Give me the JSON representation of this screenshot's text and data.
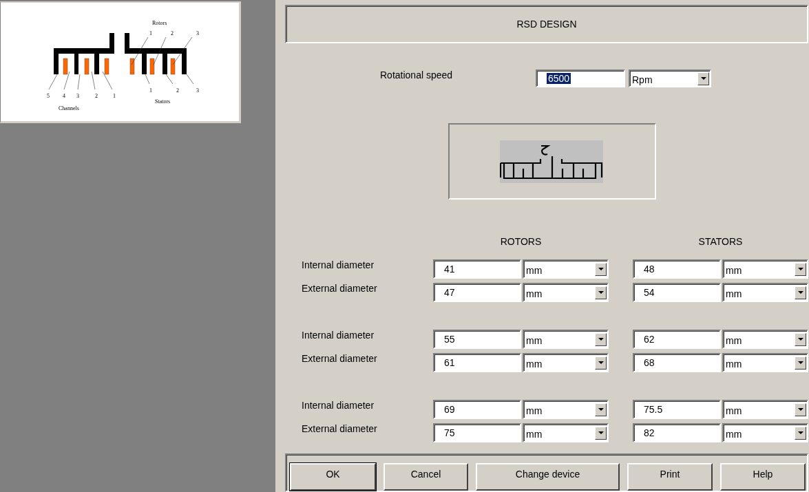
{
  "diagram": {
    "rotors_label": "Rotors",
    "rotor_numbers": [
      "1",
      "2",
      "3"
    ],
    "channel_numbers": [
      "5",
      "4",
      "3",
      "2",
      "1"
    ],
    "stator_numbers": [
      "1",
      "2",
      "3"
    ],
    "channels_label": "Channels",
    "stators_label": "Stators"
  },
  "dialog": {
    "title": "RSD DESIGN"
  },
  "speed": {
    "label": "Rotational speed",
    "value": "6500",
    "text_selected": true,
    "unit": "Rpm"
  },
  "columns": [
    "ROTORS",
    "STATORS"
  ],
  "groups": [
    {
      "rows": [
        {
          "label": "Internal diameter",
          "rotor": {
            "value": "41",
            "unit": "mm"
          },
          "stator": {
            "value": "48",
            "unit": "mm"
          }
        },
        {
          "label": "External diameter",
          "rotor": {
            "value": "47",
            "unit": "mm"
          },
          "stator": {
            "value": "54",
            "unit": "mm"
          }
        }
      ]
    },
    {
      "rows": [
        {
          "label": "Internal diameter",
          "rotor": {
            "value": "55",
            "unit": "mm"
          },
          "stator": {
            "value": "62",
            "unit": "mm"
          }
        },
        {
          "label": "External diameter",
          "rotor": {
            "value": "61",
            "unit": "mm"
          },
          "stator": {
            "value": "68",
            "unit": "mm"
          }
        }
      ]
    },
    {
      "rows": [
        {
          "label": "Internal diameter",
          "rotor": {
            "value": "69",
            "unit": "mm"
          },
          "stator": {
            "value": "75.5",
            "unit": "mm"
          }
        },
        {
          "label": "External diameter",
          "rotor": {
            "value": "75",
            "unit": "mm"
          },
          "stator": {
            "value": "82",
            "unit": "mm"
          }
        }
      ]
    }
  ],
  "buttons": [
    {
      "label": "OK",
      "default": true
    },
    {
      "label": "Cancel",
      "default": false
    },
    {
      "label": "Change device",
      "default": false
    },
    {
      "label": "Print",
      "default": false
    },
    {
      "label": "Help",
      "default": false
    }
  ]
}
